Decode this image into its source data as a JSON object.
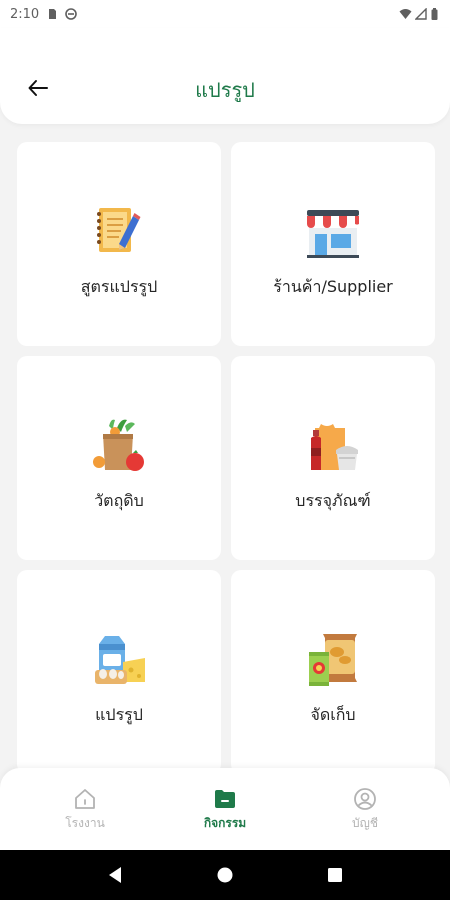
{
  "status_bar": {
    "time": "2:10",
    "icons": [
      "sd-card-icon",
      "no-disturb-icon",
      "wifi-icon",
      "signal-icon",
      "battery-icon"
    ]
  },
  "header": {
    "title": "แปรรูป",
    "back_icon": "arrow-left-icon"
  },
  "menu": {
    "items": [
      {
        "label": "สูตรแปรรูป",
        "icon": "notebook-pencil-icon"
      },
      {
        "label": "ร้านค้า/Supplier",
        "icon": "storefront-icon"
      },
      {
        "label": "วัตถุดิบ",
        "icon": "grocery-bag-icon"
      },
      {
        "label": "บรรจุภัณฑ์",
        "icon": "packaging-bottle-icon"
      },
      {
        "label": "แปรรูป",
        "icon": "milk-cheese-icon"
      },
      {
        "label": "จัดเก็บ",
        "icon": "snack-bags-icon"
      }
    ]
  },
  "bottom_nav": {
    "items": [
      {
        "label": "โรงงาน",
        "icon": "home-icon",
        "active": false
      },
      {
        "label": "กิจกรรม",
        "icon": "folder-icon",
        "active": true
      },
      {
        "label": "บัญชี",
        "icon": "user-circle-icon",
        "active": false
      }
    ]
  },
  "colors": {
    "accent": "#1f7a4a",
    "inactive": "#b3b3b3",
    "background": "#f3f3f3"
  }
}
